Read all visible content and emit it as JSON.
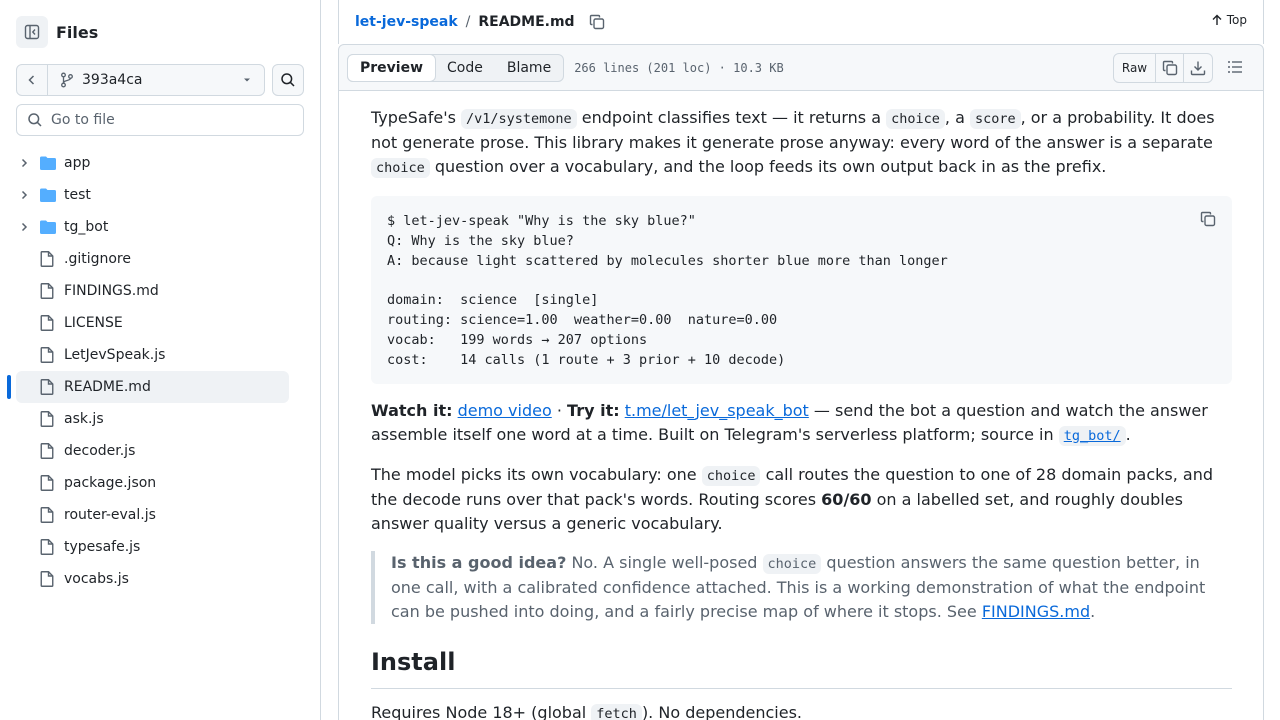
{
  "sidebar": {
    "title": "Files",
    "branch": "393a4ca",
    "goto_placeholder": "Go to file",
    "items": [
      {
        "name": "app",
        "kind": "folder"
      },
      {
        "name": "test",
        "kind": "folder"
      },
      {
        "name": "tg_bot",
        "kind": "folder"
      },
      {
        "name": ".gitignore",
        "kind": "file"
      },
      {
        "name": "FINDINGS.md",
        "kind": "file"
      },
      {
        "name": "LICENSE",
        "kind": "file"
      },
      {
        "name": "LetJevSpeak.js",
        "kind": "file"
      },
      {
        "name": "README.md",
        "kind": "file",
        "active": true
      },
      {
        "name": "ask.js",
        "kind": "file"
      },
      {
        "name": "decoder.js",
        "kind": "file"
      },
      {
        "name": "package.json",
        "kind": "file"
      },
      {
        "name": "router-eval.js",
        "kind": "file"
      },
      {
        "name": "typesafe.js",
        "kind": "file"
      },
      {
        "name": "vocabs.js",
        "kind": "file"
      }
    ]
  },
  "breadcrumb": {
    "repo": "let-jev-speak",
    "sep": "/",
    "file": "README.md",
    "top_label": "Top"
  },
  "file_header": {
    "tabs": [
      "Preview",
      "Code",
      "Blame"
    ],
    "active_tab": "Preview",
    "meta": "266 lines (201 loc) · 10.3 KB",
    "raw_label": "Raw"
  },
  "readme": {
    "p1": {
      "t1": "TypeSafe's ",
      "c1": "/v1/systemone",
      "t2": " endpoint classifies text — it returns a ",
      "c2": "choice",
      "t3": ", a ",
      "c3": "score",
      "t4": ", or a probability. It does not generate prose. This library makes it generate prose anyway: every word of the answer is a separate ",
      "c4": "choice",
      "t5": " question over a vocabulary, and the loop feeds its own output back in as the prefix."
    },
    "code_block": "$ let-jev-speak \"Why is the sky blue?\"\nQ: Why is the sky blue?\nA: because light scattered by molecules shorter blue more than longer\n\ndomain:  science  [single]\nrouting: science=1.00  weather=0.00  nature=0.00\nvocab:   199 words → 207 options\ncost:    14 calls (1 route + 3 prior + 10 decode)",
    "p2": {
      "b1": "Watch it:",
      "a1": "demo video",
      "t1": " · ",
      "b2": "Try it:",
      "a2": "t.me/let_jev_speak_bot",
      "t2": " — send the bot a question and watch the answer assemble itself one word at a time. Built on Telegram's serverless platform; source in ",
      "c1": "tg_bot/",
      "t3": "."
    },
    "p3": {
      "t1": "The model picks its own vocabulary: one ",
      "c1": "choice",
      "t2": " call routes the question to one of 28 domain packs, and the decode runs over that pack's words. Routing scores ",
      "b1": "60/60",
      "t3": " on a labelled set, and roughly doubles answer quality versus a generic vocabulary."
    },
    "quote": {
      "b1": "Is this a good idea?",
      "t1": " No. A single well-posed ",
      "c1": "choice",
      "t2": " question answers the same question better, in one call, with a calibrated confidence attached. This is a working demonstration of what the endpoint can be pushed into doing, and a fairly precise map of where it stops. See ",
      "a1": "FINDINGS.md",
      "t3": "."
    },
    "h_install": "Install",
    "p4": {
      "t1": "Requires Node 18+ (global ",
      "c1": "fetch",
      "t2": "). No dependencies."
    }
  },
  "colors": {
    "accent": "#0969da",
    "folder": "#54aeff",
    "border": "#d1d9e0"
  }
}
